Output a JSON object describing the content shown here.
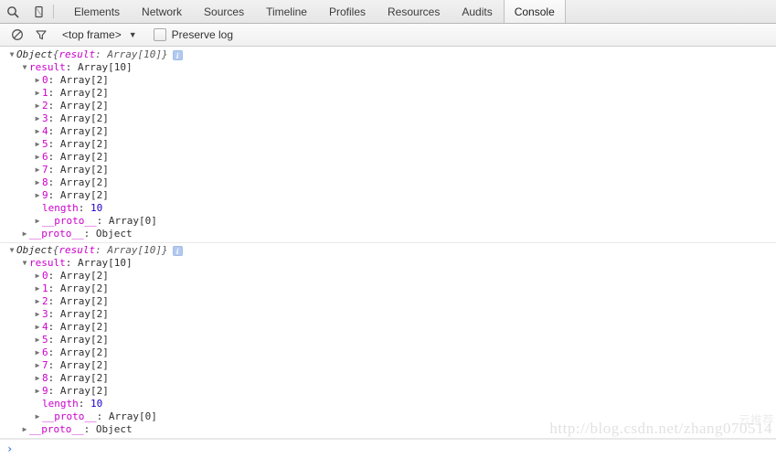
{
  "toolbar": {
    "inspect_icon": "search-icon",
    "device_icon": "mobile-device-icon",
    "tabs": [
      {
        "label": "Elements",
        "selected": false
      },
      {
        "label": "Network",
        "selected": false
      },
      {
        "label": "Sources",
        "selected": false
      },
      {
        "label": "Timeline",
        "selected": false
      },
      {
        "label": "Profiles",
        "selected": false
      },
      {
        "label": "Resources",
        "selected": false
      },
      {
        "label": "Audits",
        "selected": false
      },
      {
        "label": "Console",
        "selected": true
      }
    ]
  },
  "filterbar": {
    "clear_icon": "clear-console-icon",
    "filter_icon": "filter-funnel-icon",
    "frame_value": "<top frame>",
    "frame_caret": "▼",
    "preserve_log_label": "Preserve log",
    "preserve_log_checked": false
  },
  "console": {
    "messages": [
      {
        "header": {
          "triangle": "▼",
          "object_label": "Object",
          "preview_open": "{",
          "preview_key": "result",
          "preview_sep": ": ",
          "preview_type": "Array[10]",
          "preview_close": "}",
          "info_badge": "i"
        },
        "result_row": {
          "triangle": "▼",
          "key": "result",
          "sep": ": ",
          "type": "Array[10]"
        },
        "items": [
          {
            "triangle": "▶",
            "index": "0",
            "sep": ": ",
            "type": "Array[2]"
          },
          {
            "triangle": "▶",
            "index": "1",
            "sep": ": ",
            "type": "Array[2]"
          },
          {
            "triangle": "▶",
            "index": "2",
            "sep": ": ",
            "type": "Array[2]"
          },
          {
            "triangle": "▶",
            "index": "3",
            "sep": ": ",
            "type": "Array[2]"
          },
          {
            "triangle": "▶",
            "index": "4",
            "sep": ": ",
            "type": "Array[2]"
          },
          {
            "triangle": "▶",
            "index": "5",
            "sep": ": ",
            "type": "Array[2]"
          },
          {
            "triangle": "▶",
            "index": "6",
            "sep": ": ",
            "type": "Array[2]"
          },
          {
            "triangle": "▶",
            "index": "7",
            "sep": ": ",
            "type": "Array[2]"
          },
          {
            "triangle": "▶",
            "index": "8",
            "sep": ": ",
            "type": "Array[2]"
          },
          {
            "triangle": "▶",
            "index": "9",
            "sep": ": ",
            "type": "Array[2]"
          }
        ],
        "length_row": {
          "key": "length",
          "sep": ": ",
          "value": "10"
        },
        "inner_proto": {
          "triangle": "▶",
          "key": "__proto__",
          "sep": ": ",
          "type": "Array[0]"
        },
        "outer_proto": {
          "triangle": "▶",
          "key": "__proto__",
          "sep": ": ",
          "type": "Object"
        }
      },
      {
        "header": {
          "triangle": "▼",
          "object_label": "Object",
          "preview_open": "{",
          "preview_key": "result",
          "preview_sep": ": ",
          "preview_type": "Array[10]",
          "preview_close": "}",
          "info_badge": "i"
        },
        "result_row": {
          "triangle": "▼",
          "key": "result",
          "sep": ": ",
          "type": "Array[10]"
        },
        "items": [
          {
            "triangle": "▶",
            "index": "0",
            "sep": ": ",
            "type": "Array[2]"
          },
          {
            "triangle": "▶",
            "index": "1",
            "sep": ": ",
            "type": "Array[2]"
          },
          {
            "triangle": "▶",
            "index": "2",
            "sep": ": ",
            "type": "Array[2]"
          },
          {
            "triangle": "▶",
            "index": "3",
            "sep": ": ",
            "type": "Array[2]"
          },
          {
            "triangle": "▶",
            "index": "4",
            "sep": ": ",
            "type": "Array[2]"
          },
          {
            "triangle": "▶",
            "index": "5",
            "sep": ": ",
            "type": "Array[2]"
          },
          {
            "triangle": "▶",
            "index": "6",
            "sep": ": ",
            "type": "Array[2]"
          },
          {
            "triangle": "▶",
            "index": "7",
            "sep": ": ",
            "type": "Array[2]"
          },
          {
            "triangle": "▶",
            "index": "8",
            "sep": ": ",
            "type": "Array[2]"
          },
          {
            "triangle": "▶",
            "index": "9",
            "sep": ": ",
            "type": "Array[2]"
          }
        ],
        "length_row": {
          "key": "length",
          "sep": ": ",
          "value": "10"
        },
        "inner_proto": {
          "triangle": "▶",
          "key": "__proto__",
          "sep": ": ",
          "type": "Array[0]"
        },
        "outer_proto": {
          "triangle": "▶",
          "key": "__proto__",
          "sep": ": ",
          "type": "Object"
        }
      }
    ]
  },
  "prompt": {
    "caret": "›",
    "value": "",
    "placeholder": ""
  },
  "watermark": {
    "url": "http://blog.csdn.net/zhang070514",
    "cjk": "云推荐"
  },
  "colors": {
    "key_magenta": "#cc00cc",
    "number_blue": "#1c00cf",
    "text_gray": "#303030",
    "type_gray": "#5a5a5a",
    "info_badge": "#b3c9ef",
    "prompt_blue": "#3b78e7",
    "tab_selected_bg": "#fbfbfb"
  }
}
